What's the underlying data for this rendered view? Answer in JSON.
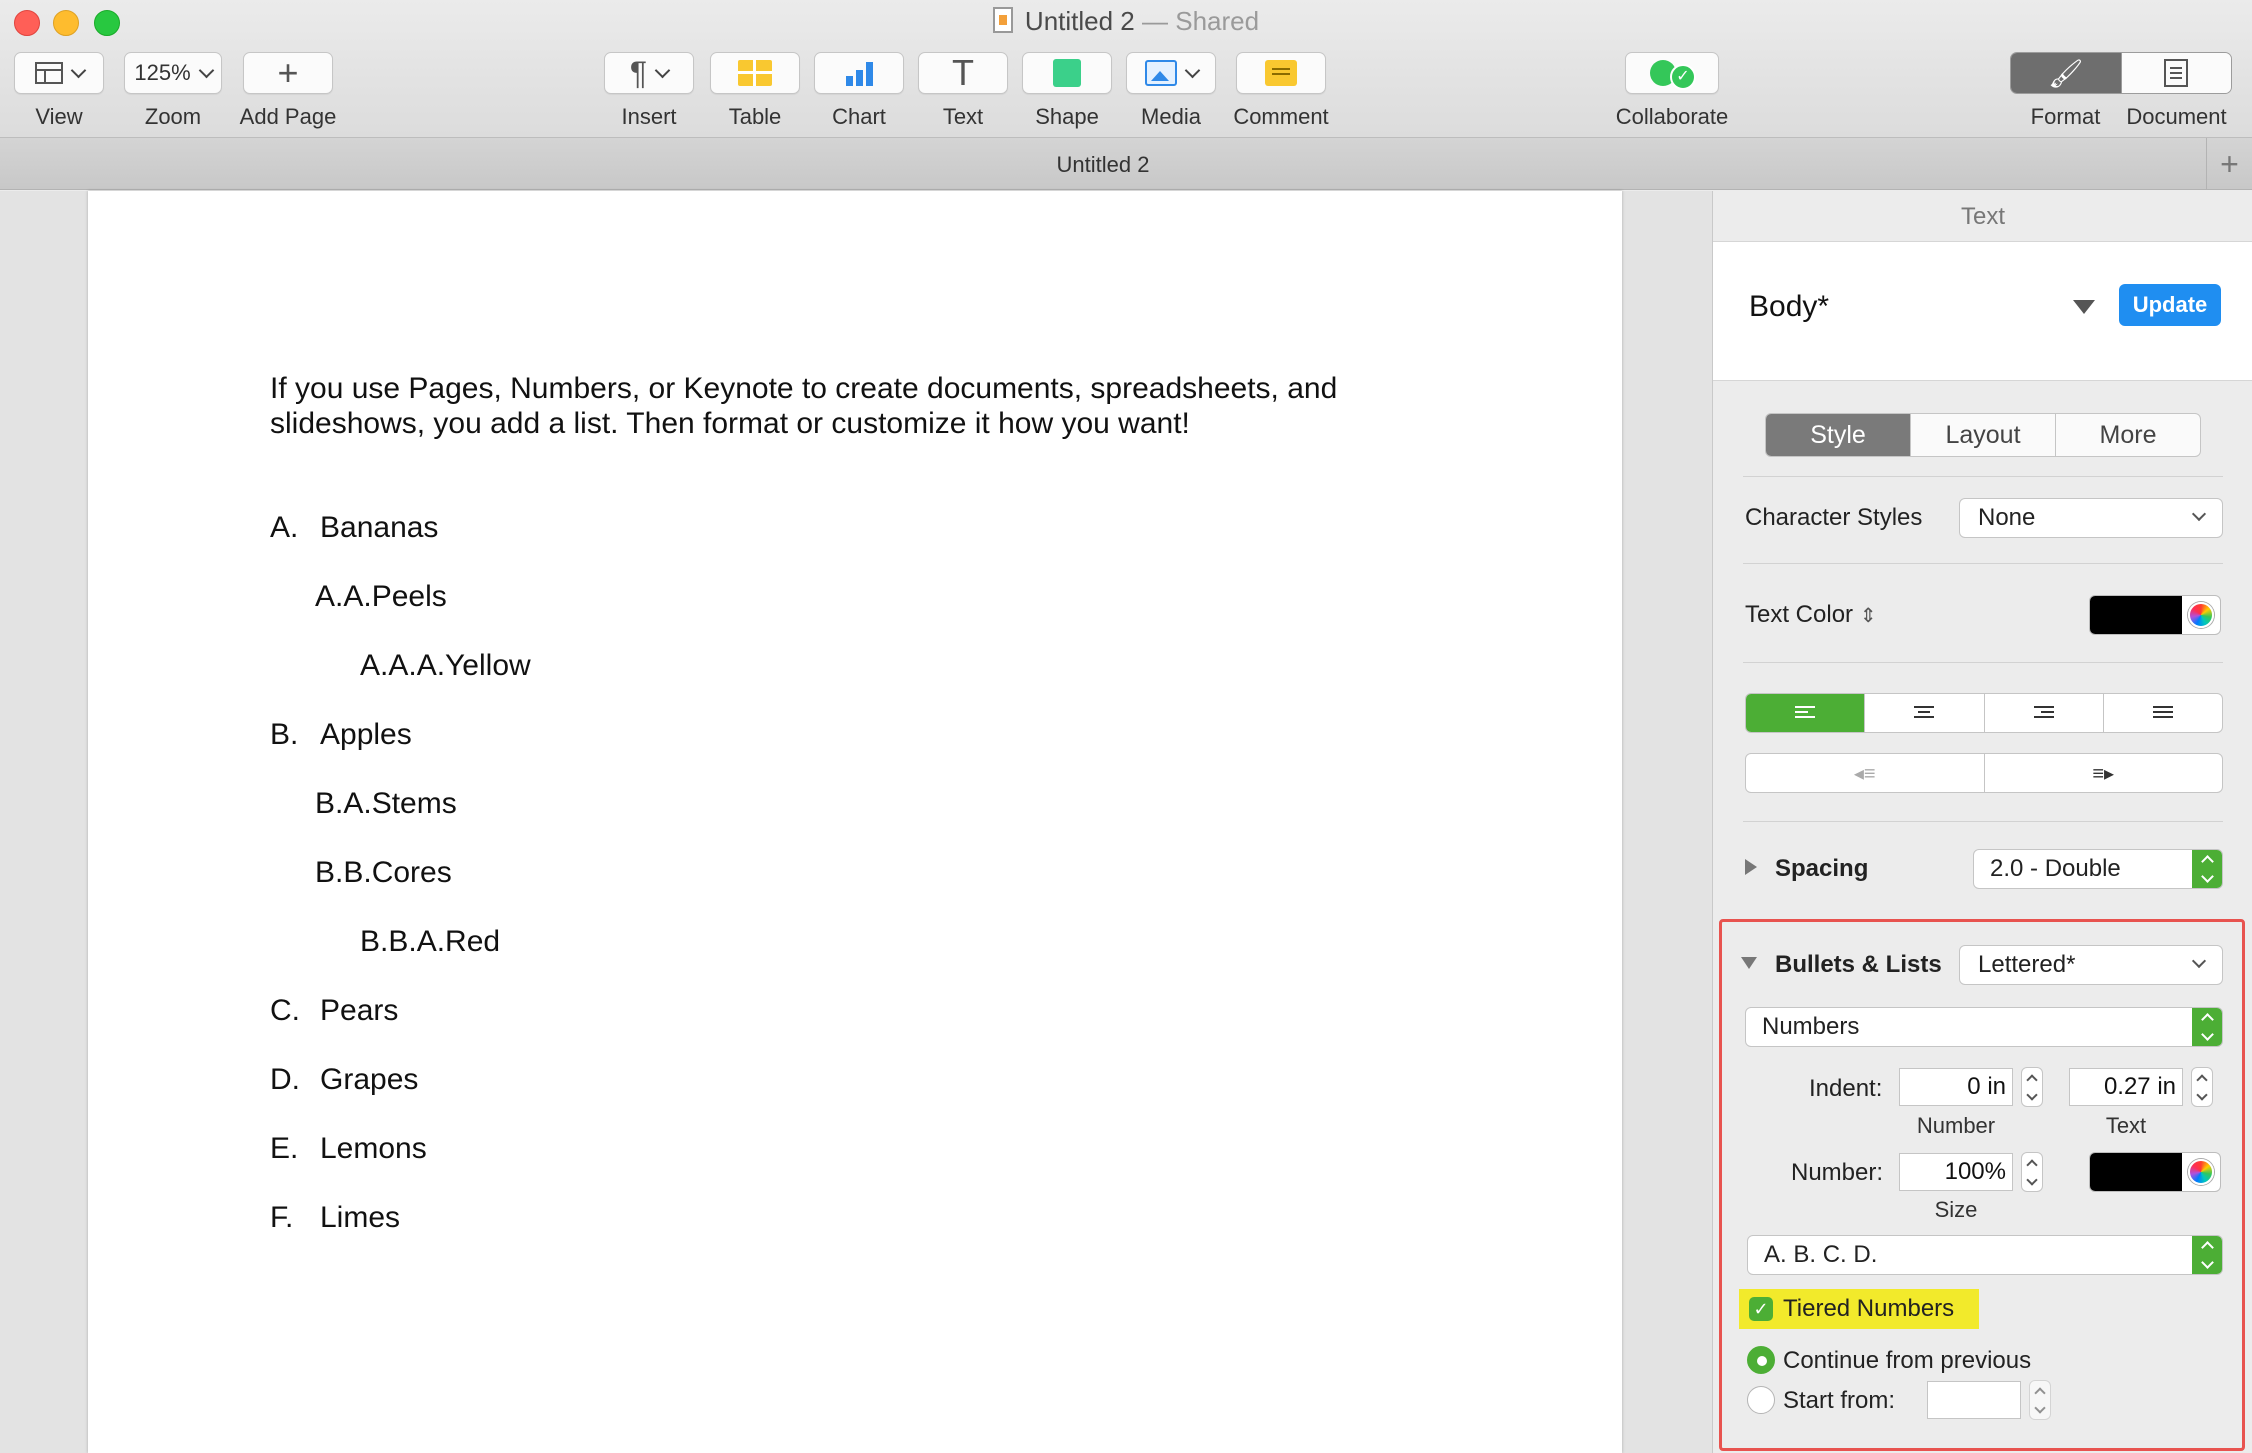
{
  "window": {
    "title": "Untitled 2",
    "title_suffix": "— Shared"
  },
  "toolbar": {
    "view": {
      "label": "View",
      "icon": "sidebar-view-icon"
    },
    "zoom": {
      "label": "Zoom",
      "value": "125%"
    },
    "add_page": {
      "label": "Add Page",
      "icon": "plus-icon"
    },
    "insert": {
      "label": "Insert",
      "icon": "pilcrow-icon"
    },
    "table": {
      "label": "Table",
      "icon": "table-icon"
    },
    "chart": {
      "label": "Chart",
      "icon": "bar-chart-icon"
    },
    "text": {
      "label": "Text",
      "icon": "text-box-icon"
    },
    "shape": {
      "label": "Shape",
      "icon": "shape-icon"
    },
    "media": {
      "label": "Media",
      "icon": "photo-icon"
    },
    "comment": {
      "label": "Comment",
      "icon": "comment-icon"
    },
    "collaborate": {
      "label": "Collaborate",
      "icon": "collaborate-icon"
    },
    "format": {
      "label": "Format",
      "icon": "paintbrush-icon"
    },
    "document": {
      "label": "Document",
      "icon": "document-icon"
    }
  },
  "tab": {
    "title": "Untitled 2",
    "add_symbol": "+"
  },
  "document": {
    "intro_line1": "If you use Pages, Numbers, or Keynote to create documents, spreadsheets, and",
    "intro_line2": "slideshows, you add a list. Then format or customize it how you want!",
    "list": [
      {
        "marker": "A.",
        "text": "Bananas",
        "level": 1
      },
      {
        "marker": "A.A.",
        "text": "Peels",
        "level": 2
      },
      {
        "marker": "A.A.A.",
        "text": "Yellow",
        "level": 3
      },
      {
        "marker": "B.",
        "text": "Apples",
        "level": 1
      },
      {
        "marker": "B.A.",
        "text": "Stems",
        "level": 2
      },
      {
        "marker": "B.B.",
        "text": "Cores",
        "level": 2
      },
      {
        "marker": "B.B.A.",
        "text": "Red",
        "level": 3
      },
      {
        "marker": "C.",
        "text": "Pears",
        "level": 1
      },
      {
        "marker": "D.",
        "text": "Grapes",
        "level": 1
      },
      {
        "marker": "E.",
        "text": "Lemons",
        "level": 1
      },
      {
        "marker": "F.",
        "text": "Limes",
        "level": 1
      }
    ]
  },
  "sidebar": {
    "title": "Text",
    "paragraph_style": "Body*",
    "update_label": "Update",
    "tabs": [
      "Style",
      "Layout",
      "More"
    ],
    "character_styles": {
      "label": "Character Styles",
      "value": "None"
    },
    "text_color": {
      "label": "Text Color",
      "color": "#000000"
    },
    "spacing": {
      "label": "Spacing",
      "value": "2.0 - Double"
    },
    "bullets": {
      "label": "Bullets & Lists",
      "preset": "Lettered*",
      "type": "Numbers",
      "indent_label": "Indent:",
      "indent_number": "0 in",
      "indent_text": "0.27 in",
      "number_sub": "Number",
      "text_sub": "Text",
      "number_label": "Number:",
      "size_value": "100%",
      "size_sub": "Size",
      "format": "A. B. C. D.",
      "tiered": "Tiered Numbers",
      "continue": "Continue from previous",
      "start_from": "Start from:"
    }
  },
  "colors": {
    "accent_green": "#4cae35",
    "update_blue": "#1f8ef1",
    "highlight_red": "#e8534f",
    "highlight_yellow": "#f2ea2b"
  }
}
